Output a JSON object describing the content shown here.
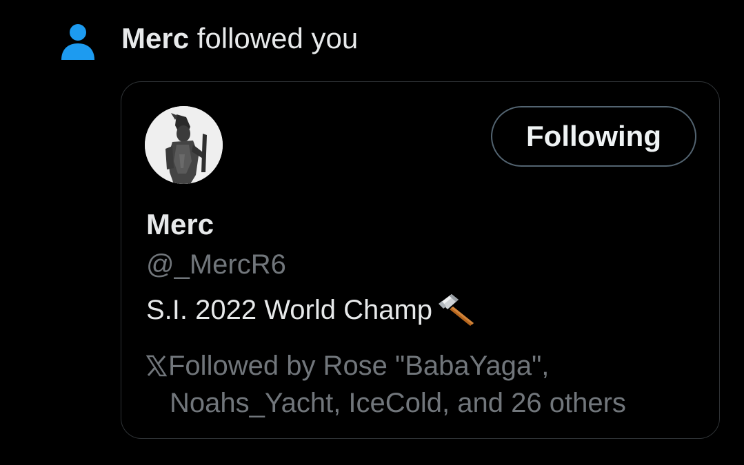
{
  "notification": {
    "actor_name": "Merc",
    "action_text": " followed you",
    "icon": "person-icon",
    "icon_color": "#1d9bf0"
  },
  "profile_card": {
    "avatar": "knight-avatar",
    "follow_button_label": "Following",
    "display_name": "Merc",
    "handle": "@_MercR6",
    "bio_text": "S.I. 2022 World Champ",
    "bio_emoji": "hammer-icon",
    "followed_by_icon": "x-logo-icon",
    "followed_by_line1": "Followed by Rose \"BabaYaga\",",
    "followed_by_line2": "Noahs_Yacht, IceCold, and 26 others"
  },
  "colors": {
    "background": "#000000",
    "primary_text": "#e7e9ea",
    "secondary_text": "#71767b",
    "card_border": "#2f3336",
    "button_border": "#536471"
  }
}
